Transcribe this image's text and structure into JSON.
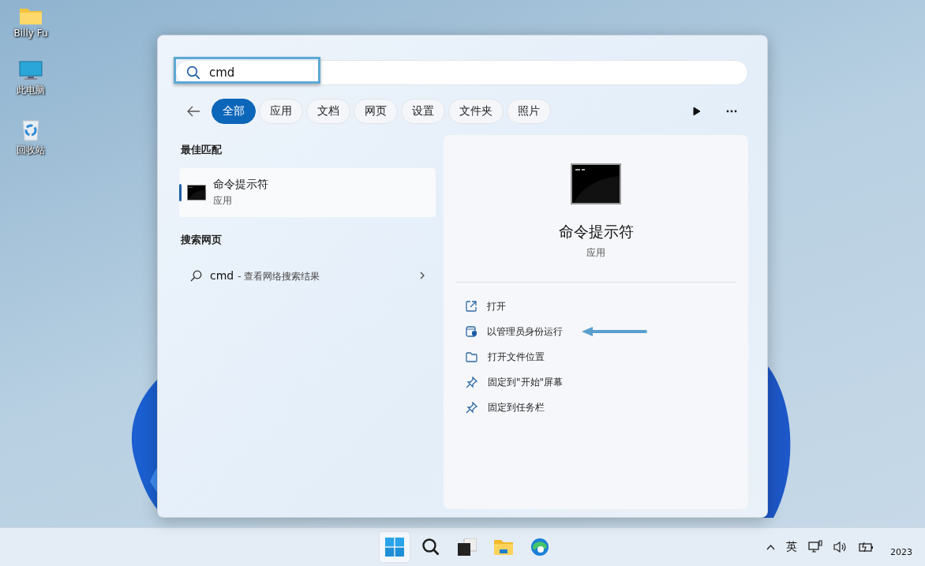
{
  "desktop_icons": [
    {
      "label": "Billy Fu",
      "kind": "folder"
    },
    {
      "label": "此电脑",
      "kind": "computer"
    },
    {
      "label": "回收站",
      "kind": "recycle"
    }
  ],
  "search": {
    "value": "cmd"
  },
  "filters": [
    {
      "label": "全部",
      "selected": true
    },
    {
      "label": "应用",
      "selected": false
    },
    {
      "label": "文档",
      "selected": false
    },
    {
      "label": "网页",
      "selected": false
    },
    {
      "label": "设置",
      "selected": false
    },
    {
      "label": "文件夹",
      "selected": false
    },
    {
      "label": "照片",
      "selected": false
    }
  ],
  "best_match": {
    "heading": "最佳匹配",
    "title": "命令提示符",
    "subtitle": "应用",
    "selected": true
  },
  "web": {
    "heading": "搜索网页",
    "query": "cmd",
    "suffix": "- 查看网络搜索结果"
  },
  "detail": {
    "title": "命令提示符",
    "subtitle": "应用",
    "actions": [
      {
        "label": "打开",
        "kind": "open"
      },
      {
        "label": "以管理员身份运行",
        "kind": "admin"
      },
      {
        "label": "打开文件位置",
        "kind": "folder"
      },
      {
        "label": "固定到\"开始\"屏幕",
        "kind": "pin"
      },
      {
        "label": "固定到任务栏",
        "kind": "pin"
      }
    ]
  },
  "taskbar": {
    "apps": [
      {
        "kind": "start",
        "selected": true
      },
      {
        "kind": "search",
        "selected": false
      },
      {
        "kind": "taskview",
        "selected": false
      },
      {
        "kind": "explorer",
        "selected": false
      },
      {
        "kind": "browser",
        "selected": false
      }
    ],
    "ime": "英",
    "clock": "2023"
  }
}
